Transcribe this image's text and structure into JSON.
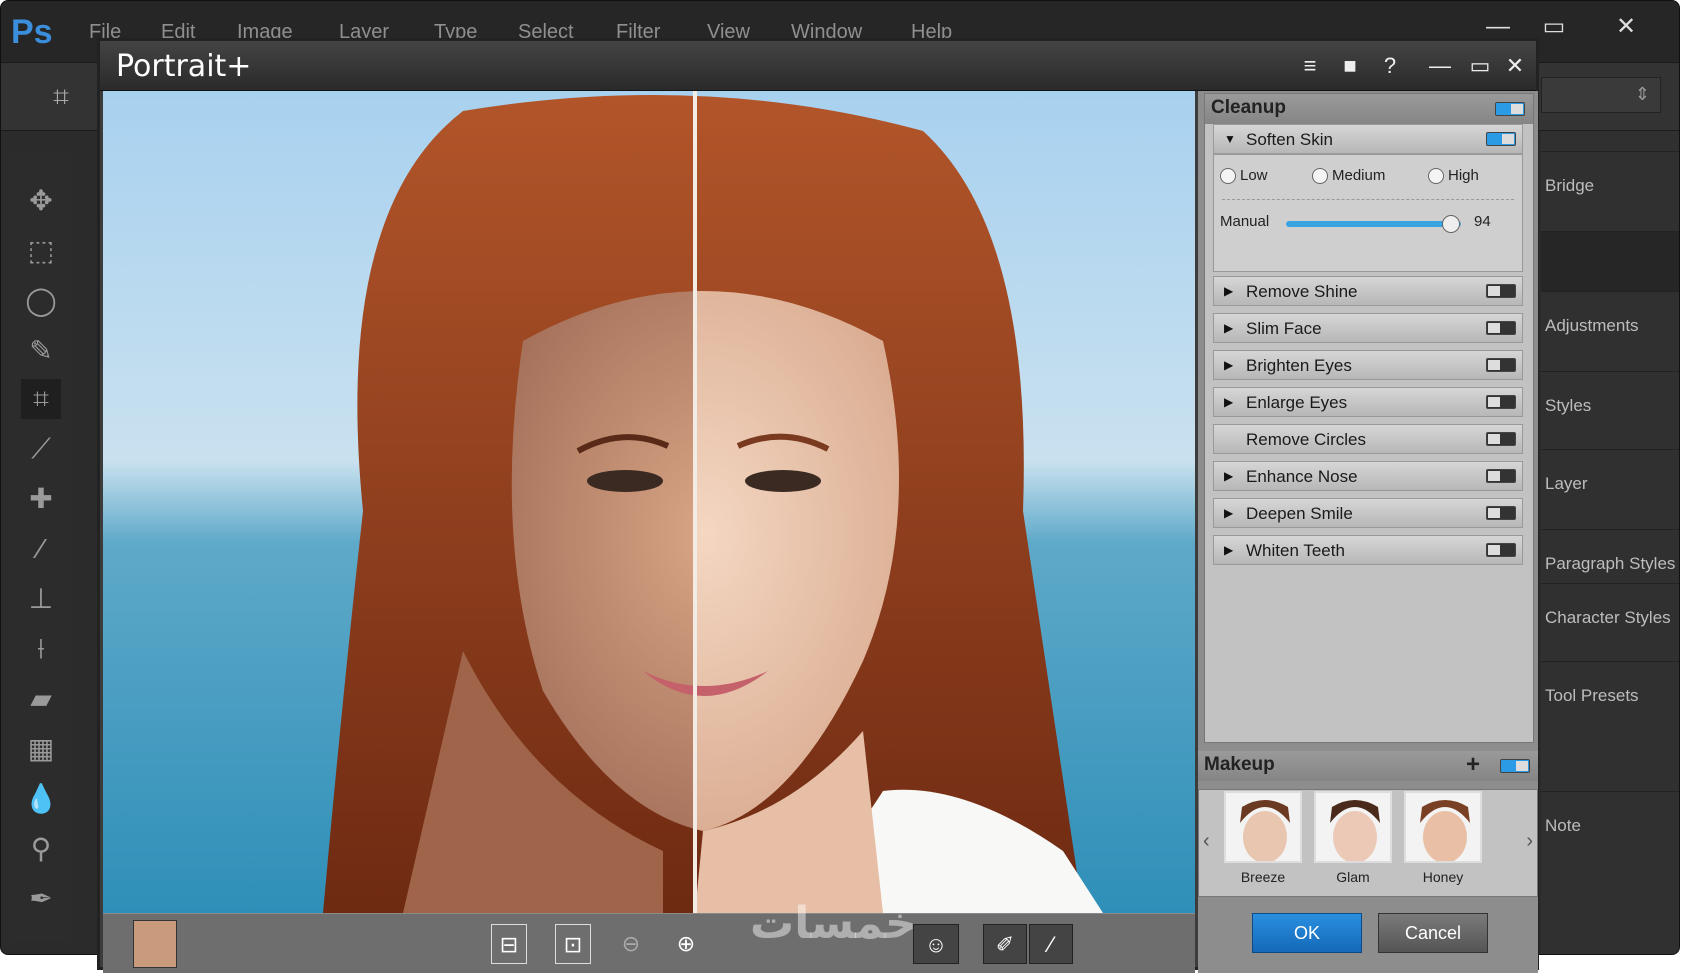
{
  "photoshop": {
    "logo": "Ps",
    "menu": [
      "File",
      "Edit",
      "Image",
      "Layer",
      "Type",
      "Select",
      "Filter",
      "View",
      "Window",
      "Help"
    ],
    "window_controls": {
      "minimize": "—",
      "maximize": "▭",
      "close": "✕"
    },
    "right_panel": [
      "Bridge",
      "",
      "Adjustments",
      "Styles",
      "Layer",
      "Paragraph Styles",
      "Character Styles",
      "Tool Presets",
      "Note"
    ]
  },
  "dialog": {
    "title": "Portrait+",
    "buttons": {
      "menu": "≡",
      "comment": "■",
      "help": "?",
      "minimize": "—",
      "maximize": "▭",
      "close": "✕"
    }
  },
  "cleanup": {
    "header": "Cleanup",
    "soften_skin": {
      "label": "Soften Skin",
      "options": [
        "Low",
        "Medium",
        "High"
      ],
      "manual_label": "Manual",
      "manual_value": "94",
      "manual_fraction": 0.94
    },
    "items": [
      {
        "label": "Remove Shine",
        "arrow": true
      },
      {
        "label": "Slim Face",
        "arrow": true
      },
      {
        "label": "Brighten Eyes",
        "arrow": true
      },
      {
        "label": "Enlarge Eyes",
        "arrow": true
      },
      {
        "label": "Remove Circles",
        "arrow": false
      },
      {
        "label": "Enhance Nose",
        "arrow": true
      },
      {
        "label": "Deepen Smile",
        "arrow": true
      },
      {
        "label": "Whiten Teeth",
        "arrow": true
      }
    ]
  },
  "makeup": {
    "header": "Makeup",
    "add": "+",
    "presets": [
      "Breeze",
      "Glam",
      "Honey"
    ],
    "prev": "‹",
    "next": "›"
  },
  "actions": {
    "ok": "OK",
    "cancel": "Cancel"
  },
  "watermark": "خمسات",
  "colors": {
    "accent": "#2c9be6",
    "ok_button": "#1a7ad0",
    "panel": "#c2c2c2"
  }
}
